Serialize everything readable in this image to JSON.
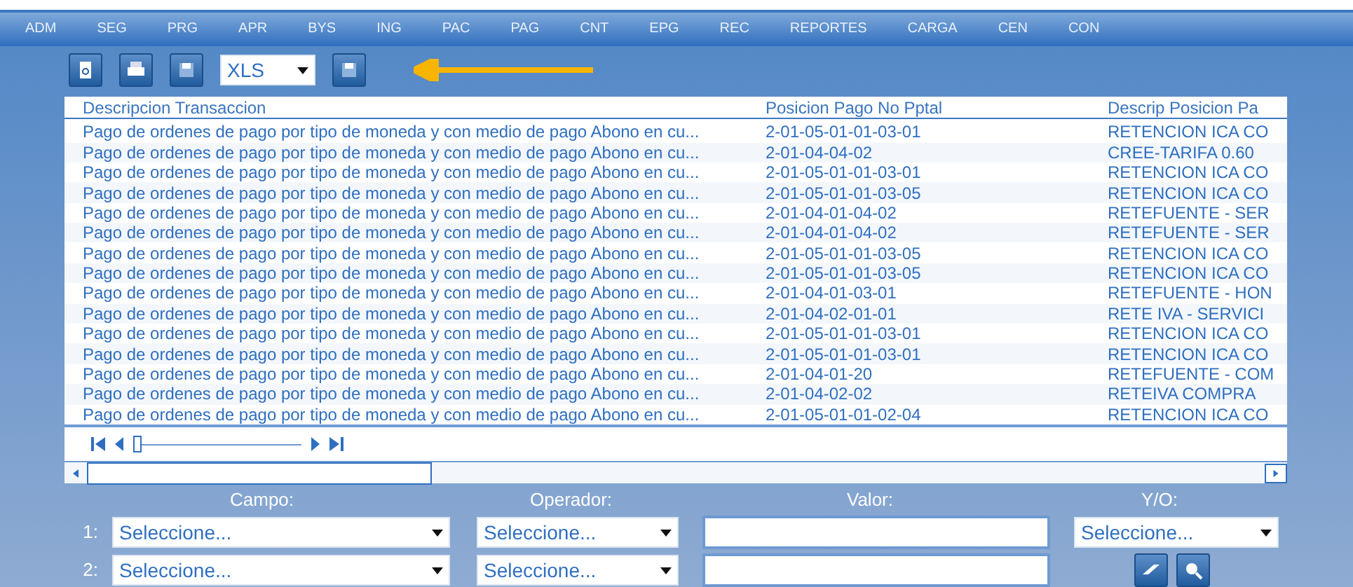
{
  "menu": [
    "ADM",
    "SEG",
    "PRG",
    "APR",
    "BYS",
    "ING",
    "PAC",
    "PAG",
    "CNT",
    "EPG",
    "REC",
    "REPORTES",
    "CARGA",
    "CEN",
    "CON"
  ],
  "toolbar": {
    "export_format": "XLS"
  },
  "table": {
    "columns": [
      "Descripcion Transaccion",
      "Posicion Pago No Pptal",
      "Descrip Posicion Pa"
    ],
    "rows": [
      {
        "description": "Pago de ordenes de pago por tipo de moneda y con medio de pago Abono en cu...",
        "position": "2-01-05-01-01-03-01",
        "position_description": "RETENCION ICA CO"
      },
      {
        "description": "Pago de ordenes de pago por tipo de moneda y con medio de pago Abono en cu...",
        "position": "2-01-04-04-02",
        "position_description": "CREE-TARIFA 0.60"
      },
      {
        "description": "Pago de ordenes de pago por tipo de moneda y con medio de pago Abono en cu...",
        "position": "2-01-05-01-01-03-01",
        "position_description": "RETENCION ICA CO"
      },
      {
        "description": "Pago de ordenes de pago por tipo de moneda y con medio de pago Abono en cu...",
        "position": "2-01-05-01-01-03-05",
        "position_description": "RETENCION ICA CO"
      },
      {
        "description": "Pago de ordenes de pago por tipo de moneda y con medio de pago Abono en cu...",
        "position": "2-01-04-01-04-02",
        "position_description": "RETEFUENTE - SER"
      },
      {
        "description": "Pago de ordenes de pago por tipo de moneda y con medio de pago Abono en cu...",
        "position": "2-01-04-01-04-02",
        "position_description": "RETEFUENTE - SER"
      },
      {
        "description": "Pago de ordenes de pago por tipo de moneda y con medio de pago Abono en cu...",
        "position": "2-01-05-01-01-03-05",
        "position_description": "RETENCION ICA CO"
      },
      {
        "description": "Pago de ordenes de pago por tipo de moneda y con medio de pago Abono en cu...",
        "position": "2-01-05-01-01-03-05",
        "position_description": "RETENCION ICA CO"
      },
      {
        "description": "Pago de ordenes de pago por tipo de moneda y con medio de pago Abono en cu...",
        "position": "2-01-04-01-03-01",
        "position_description": "RETEFUENTE - HON"
      },
      {
        "description": "Pago de ordenes de pago por tipo de moneda y con medio de pago Abono en cu...",
        "position": "2-01-04-02-01-01",
        "position_description": "RETE IVA - SERVICI"
      },
      {
        "description": "Pago de ordenes de pago por tipo de moneda y con medio de pago Abono en cu...",
        "position": "2-01-05-01-01-03-01",
        "position_description": "RETENCION ICA CO"
      },
      {
        "description": "Pago de ordenes de pago por tipo de moneda y con medio de pago Abono en cu...",
        "position": "2-01-05-01-01-03-01",
        "position_description": "RETENCION ICA CO"
      },
      {
        "description": "Pago de ordenes de pago por tipo de moneda y con medio de pago Abono en cu...",
        "position": "2-01-04-01-20",
        "position_description": "RETEFUENTE - COM"
      },
      {
        "description": "Pago de ordenes de pago por tipo de moneda y con medio de pago Abono en cu...",
        "position": "2-01-04-02-02",
        "position_description": "RETEIVA COMPRA"
      },
      {
        "description": "Pago de ordenes de pago por tipo de moneda y con medio de pago Abono en cu...",
        "position": "2-01-05-01-01-02-04",
        "position_description": "RETENCION ICA CO"
      }
    ]
  },
  "pager": {
    "level": 0
  },
  "filters": {
    "headers": [
      "Campo:",
      "Operador:",
      "Valor:",
      "Y/O:"
    ],
    "rows": [
      {
        "number": "1:",
        "field": "Seleccione...",
        "operator": "Seleccione...",
        "connector": "Seleccione..."
      },
      {
        "number": "2:",
        "field": "Seleccione...",
        "operator": "Seleccione..."
      }
    ]
  }
}
